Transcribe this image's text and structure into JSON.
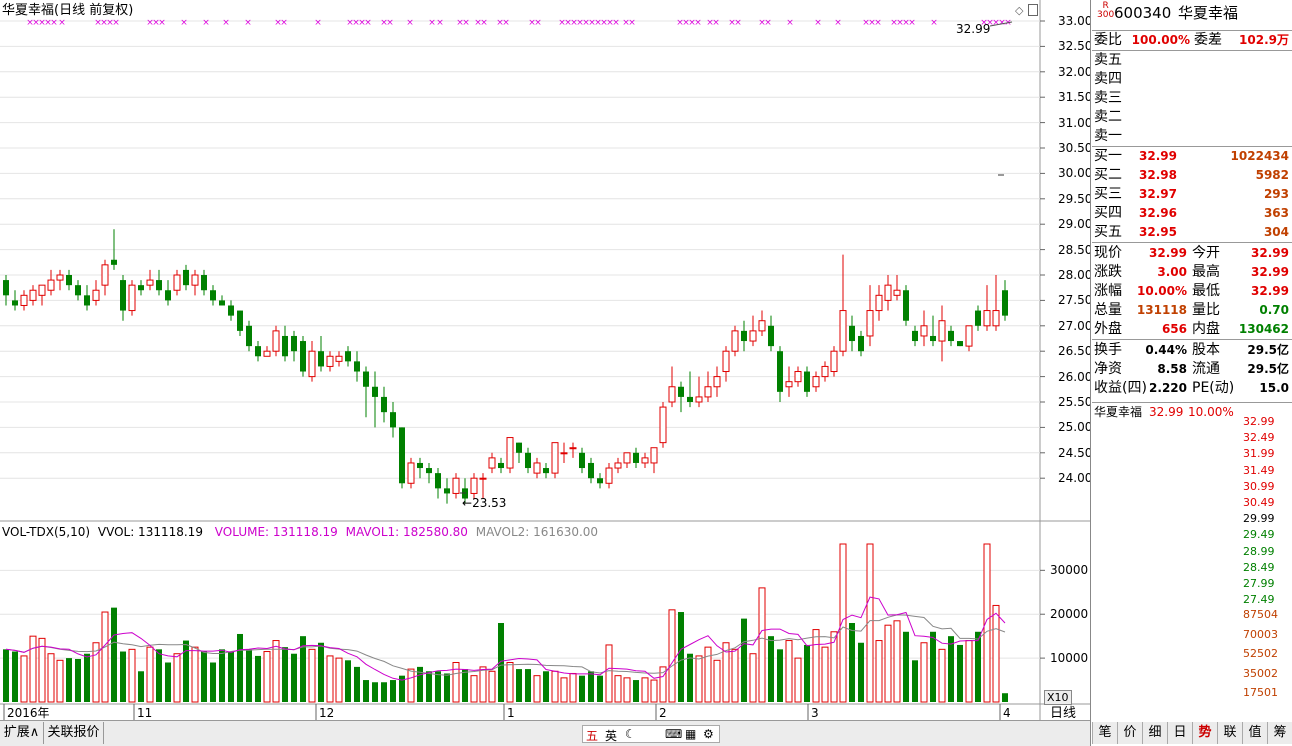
{
  "header": {
    "title": "华夏幸福(日线 前复权)",
    "last_price_marker": "32.99",
    "low_marker": "23.53"
  },
  "price_axis": [
    "33.00",
    "32.50",
    "32.00",
    "31.50",
    "31.00",
    "30.50",
    "30.00",
    "29.50",
    "29.00",
    "28.50",
    "28.00",
    "27.50",
    "27.00",
    "26.50",
    "26.00",
    "25.50",
    "25.00",
    "24.50",
    "24.00"
  ],
  "volume_axis": [
    "30000",
    "20000",
    "10000"
  ],
  "volume_multiplier": "X10",
  "volume_header": {
    "indicator": "VOL-TDX(5,10)",
    "vvol": "VVOL: 131118.19",
    "volume": "VOLUME: 131118.19",
    "mavol1": "MAVOL1: 182580.80",
    "mavol2": "MAVOL2: 161630.00"
  },
  "date_axis": [
    "2016年",
    "11",
    "12",
    "1",
    "2",
    "3",
    "4"
  ],
  "period_label": "日线",
  "bottom_tabs": {
    "expand": "扩展∧",
    "related": "关联报价"
  },
  "toolbar_center": [
    "五",
    "英",
    "☾",
    "⌨",
    "▦",
    "⚙"
  ],
  "quote": {
    "code": "600340",
    "name": "华夏幸福",
    "badge": "R\n300",
    "weibi_label": "委比",
    "weibi": "100.00%",
    "weicha_label": "委差",
    "weicha": "102.9万",
    "sell": [
      {
        "label": "卖五",
        "price": "",
        "vol": ""
      },
      {
        "label": "卖四",
        "price": "",
        "vol": ""
      },
      {
        "label": "卖三",
        "price": "",
        "vol": ""
      },
      {
        "label": "卖二",
        "price": "",
        "vol": ""
      },
      {
        "label": "卖一",
        "price": "",
        "vol": ""
      }
    ],
    "buy": [
      {
        "label": "买一",
        "price": "32.99",
        "vol": "1022434"
      },
      {
        "label": "买二",
        "price": "32.98",
        "vol": "5982"
      },
      {
        "label": "买三",
        "price": "32.97",
        "vol": "293"
      },
      {
        "label": "买四",
        "price": "32.96",
        "vol": "363"
      },
      {
        "label": "买五",
        "price": "32.95",
        "vol": "304"
      }
    ],
    "stats": [
      {
        "l1": "现价",
        "v1": "32.99",
        "c1": "red",
        "l2": "今开",
        "v2": "32.99",
        "c2": "red"
      },
      {
        "l1": "涨跌",
        "v1": "3.00",
        "c1": "red",
        "l2": "最高",
        "v2": "32.99",
        "c2": "red"
      },
      {
        "l1": "涨幅",
        "v1": "10.00%",
        "c1": "red",
        "l2": "最低",
        "v2": "32.99",
        "c2": "red"
      },
      {
        "l1": "总量",
        "v1": "131118",
        "c1": "dred",
        "l2": "量比",
        "v2": "0.70",
        "c2": "grn"
      },
      {
        "l1": "外盘",
        "v1": "656",
        "c1": "red",
        "l2": "内盘",
        "v2": "130462",
        "c2": "grn"
      }
    ],
    "fin": [
      {
        "l1": "换手",
        "v1": "0.44%",
        "l2": "股本",
        "v2": "29.5亿"
      },
      {
        "l1": "净资",
        "v1": "8.58",
        "l2": "流通",
        "v2": "29.5亿"
      },
      {
        "l1": "收益(四)",
        "v1": "2.220",
        "l2": "PE(动)",
        "v2": "15.0"
      }
    ]
  },
  "mini_chart": {
    "name": "华夏幸福",
    "price": "32.99",
    "pct": "10.00%",
    "price_ticks": [
      "32.99",
      "32.49",
      "31.99",
      "31.49",
      "30.99",
      "30.49",
      "29.99",
      "29.49",
      "28.99",
      "28.49",
      "27.99",
      "27.49"
    ],
    "vol_ticks": [
      "87504",
      "70003",
      "52502",
      "35002",
      "17501"
    ]
  },
  "side_tabs": [
    "笔",
    "价",
    "细",
    "日",
    "势",
    "联",
    "值",
    "筹"
  ],
  "colors": {
    "up": "#e00000",
    "down": "#008000",
    "mavol1": "#cc00cc",
    "mavol2": "#888888",
    "marker": "#dd00dd"
  },
  "chart_data": {
    "type": "candlestick",
    "ylim": [
      23.5,
      33.2
    ],
    "candles": [
      [
        27.9,
        27.6,
        28.0,
        27.4
      ],
      [
        27.5,
        27.4,
        27.7,
        27.3
      ],
      [
        27.4,
        27.6,
        27.7,
        27.3
      ],
      [
        27.5,
        27.7,
        27.8,
        27.4
      ],
      [
        27.6,
        27.8,
        27.8,
        27.4
      ],
      [
        27.7,
        27.9,
        28.1,
        27.6
      ],
      [
        27.9,
        28.0,
        28.1,
        27.7
      ],
      [
        28.0,
        27.8,
        28.1,
        27.7
      ],
      [
        27.8,
        27.6,
        27.9,
        27.5
      ],
      [
        27.6,
        27.4,
        27.8,
        27.3
      ],
      [
        27.5,
        27.7,
        27.9,
        27.4
      ],
      [
        27.8,
        28.2,
        28.3,
        27.6
      ],
      [
        28.3,
        28.2,
        28.9,
        28.1
      ],
      [
        27.9,
        27.3,
        28.0,
        27.1
      ],
      [
        27.3,
        27.8,
        27.9,
        27.2
      ],
      [
        27.8,
        27.7,
        27.9,
        27.6
      ],
      [
        27.8,
        27.9,
        28.1,
        27.7
      ],
      [
        27.9,
        27.7,
        28.1,
        27.6
      ],
      [
        27.7,
        27.5,
        27.9,
        27.4
      ],
      [
        27.7,
        28.0,
        28.1,
        27.6
      ],
      [
        28.1,
        27.8,
        28.2,
        27.7
      ],
      [
        27.8,
        28.0,
        28.1,
        27.6
      ],
      [
        28.0,
        27.7,
        28.1,
        27.6
      ],
      [
        27.7,
        27.5,
        27.8,
        27.4
      ],
      [
        27.5,
        27.4,
        27.6,
        27.4
      ],
      [
        27.4,
        27.2,
        27.5,
        27.1
      ],
      [
        27.3,
        26.9,
        27.3,
        26.8
      ],
      [
        27.0,
        26.6,
        27.1,
        26.5
      ],
      [
        26.6,
        26.4,
        26.7,
        26.3
      ],
      [
        26.4,
        26.5,
        26.6,
        26.4
      ],
      [
        26.5,
        26.9,
        27.0,
        26.4
      ],
      [
        26.8,
        26.4,
        27.0,
        26.3
      ],
      [
        26.8,
        26.5,
        26.9,
        26.3
      ],
      [
        26.7,
        26.1,
        26.8,
        26.0
      ],
      [
        26.0,
        26.5,
        26.7,
        25.9
      ],
      [
        26.5,
        26.2,
        26.8,
        26.1
      ],
      [
        26.2,
        26.4,
        26.5,
        26.1
      ],
      [
        26.3,
        26.4,
        26.5,
        26.2
      ],
      [
        26.5,
        26.3,
        26.6,
        26.2
      ],
      [
        26.3,
        26.1,
        26.5,
        25.9
      ],
      [
        26.1,
        25.8,
        26.2,
        25.2
      ],
      [
        25.8,
        25.6,
        26.1,
        25.0
      ],
      [
        25.6,
        25.3,
        25.8,
        25.1
      ],
      [
        25.3,
        25.0,
        25.5,
        24.8
      ],
      [
        25.0,
        23.9,
        25.0,
        23.8
      ],
      [
        23.9,
        24.3,
        24.4,
        23.8
      ],
      [
        24.3,
        24.2,
        24.4,
        24.0
      ],
      [
        24.2,
        24.1,
        24.3,
        23.9
      ],
      [
        24.1,
        23.8,
        24.2,
        23.6
      ],
      [
        23.8,
        23.7,
        24.0,
        23.5
      ],
      [
        23.7,
        24.0,
        24.1,
        23.6
      ],
      [
        23.8,
        23.6,
        24.0,
        23.5
      ],
      [
        23.7,
        24.0,
        24.1,
        23.6
      ],
      [
        24.0,
        24.0,
        24.1,
        23.6
      ],
      [
        24.2,
        24.4,
        24.5,
        24.1
      ],
      [
        24.3,
        24.2,
        24.4,
        24.1
      ],
      [
        24.2,
        24.8,
        24.8,
        24.1
      ],
      [
        24.7,
        24.5,
        24.7,
        24.3
      ],
      [
        24.5,
        24.2,
        24.6,
        24.1
      ],
      [
        24.1,
        24.3,
        24.4,
        24.0
      ],
      [
        24.2,
        24.1,
        24.3,
        24.0
      ],
      [
        24.1,
        24.7,
        24.7,
        24.0
      ],
      [
        24.5,
        24.5,
        24.7,
        24.3
      ],
      [
        24.6,
        24.6,
        24.7,
        24.4
      ],
      [
        24.5,
        24.2,
        24.6,
        24.1
      ],
      [
        24.3,
        24.0,
        24.4,
        23.9
      ],
      [
        24.0,
        23.9,
        24.1,
        23.8
      ],
      [
        23.9,
        24.2,
        24.3,
        23.8
      ],
      [
        24.2,
        24.3,
        24.4,
        24.1
      ],
      [
        24.3,
        24.5,
        24.5,
        24.2
      ],
      [
        24.5,
        24.3,
        24.6,
        24.2
      ],
      [
        24.3,
        24.4,
        24.5,
        24.2
      ],
      [
        24.3,
        24.6,
        24.6,
        24.1
      ],
      [
        24.7,
        25.4,
        25.5,
        24.6
      ],
      [
        25.5,
        25.8,
        26.2,
        25.4
      ],
      [
        25.8,
        25.6,
        25.9,
        25.3
      ],
      [
        25.6,
        25.5,
        26.1,
        25.4
      ],
      [
        25.5,
        25.6,
        26.0,
        25.4
      ],
      [
        25.6,
        25.8,
        26.1,
        25.5
      ],
      [
        25.8,
        26.0,
        26.2,
        25.6
      ],
      [
        26.1,
        26.5,
        26.6,
        25.9
      ],
      [
        26.5,
        26.9,
        27.0,
        26.4
      ],
      [
        26.9,
        26.7,
        27.1,
        26.5
      ],
      [
        26.7,
        26.9,
        27.2,
        26.6
      ],
      [
        26.9,
        27.1,
        27.3,
        26.8
      ],
      [
        27.0,
        26.6,
        27.2,
        26.5
      ],
      [
        26.5,
        25.7,
        26.6,
        25.5
      ],
      [
        25.8,
        25.9,
        26.2,
        25.6
      ],
      [
        25.9,
        26.1,
        26.2,
        25.8
      ],
      [
        26.1,
        25.7,
        26.2,
        25.6
      ],
      [
        25.8,
        26.0,
        26.1,
        25.7
      ],
      [
        26.0,
        26.2,
        26.3,
        25.9
      ],
      [
        26.1,
        26.5,
        26.6,
        26.0
      ],
      [
        26.5,
        27.3,
        28.4,
        26.4
      ],
      [
        27.0,
        26.7,
        27.2,
        26.5
      ],
      [
        26.8,
        26.5,
        26.9,
        26.4
      ],
      [
        26.8,
        27.3,
        27.8,
        26.6
      ],
      [
        27.3,
        27.6,
        27.8,
        27.1
      ],
      [
        27.5,
        27.8,
        28.0,
        27.3
      ],
      [
        27.6,
        27.7,
        28.0,
        27.5
      ],
      [
        27.7,
        27.1,
        27.8,
        27.0
      ],
      [
        26.9,
        26.7,
        27.0,
        26.6
      ],
      [
        26.8,
        27.0,
        27.3,
        26.6
      ],
      [
        26.8,
        26.7,
        27.2,
        26.6
      ],
      [
        26.7,
        27.1,
        27.4,
        26.3
      ],
      [
        26.9,
        26.7,
        27.0,
        26.6
      ],
      [
        26.7,
        26.6,
        26.7,
        26.6
      ],
      [
        26.6,
        27.0,
        27.0,
        26.5
      ],
      [
        27.3,
        27.0,
        27.4,
        26.9
      ],
      [
        27.0,
        27.3,
        27.8,
        26.9
      ],
      [
        27.0,
        27.3,
        28.0,
        26.9
      ],
      [
        27.7,
        27.2,
        27.9,
        27.1
      ]
    ],
    "volumes": [
      12000,
      11500,
      10500,
      15000,
      14500,
      11000,
      9500,
      10000,
      9800,
      11000,
      13500,
      20500,
      21500,
      11500,
      12000,
      7000,
      12500,
      12000,
      9000,
      11000,
      14000,
      12500,
      11500,
      9000,
      12000,
      11500,
      15500,
      12000,
      10500,
      11500,
      14000,
      12500,
      11000,
      15000,
      12000,
      13500,
      10500,
      10000,
      9500,
      8000,
      5000,
      4500,
      4500,
      5000,
      6000,
      7500,
      8000,
      7000,
      7000,
      6500,
      9000,
      7500,
      6000,
      8000,
      7000,
      18000,
      9000,
      7500,
      7500,
      6000,
      7000,
      7000,
      5500,
      6500,
      6000,
      7000,
      6000,
      13000,
      6000,
      5500,
      5000,
      5500,
      5000,
      8000,
      21000,
      20500,
      11000,
      10500,
      12500,
      9500,
      13500,
      12000,
      19000,
      11000,
      26000,
      15000,
      12000,
      14000,
      10000,
      13000,
      16500,
      12500,
      16000,
      36000,
      18000,
      13500,
      36000,
      14000,
      17500,
      18500,
      16000,
      9500,
      13500,
      16000,
      12000,
      15000,
      13000,
      14000,
      16000,
      36000,
      22000,
      2000
    ],
    "mavol1_hint": "magenta moving average line",
    "mavol2_hint": "gray moving average line"
  }
}
